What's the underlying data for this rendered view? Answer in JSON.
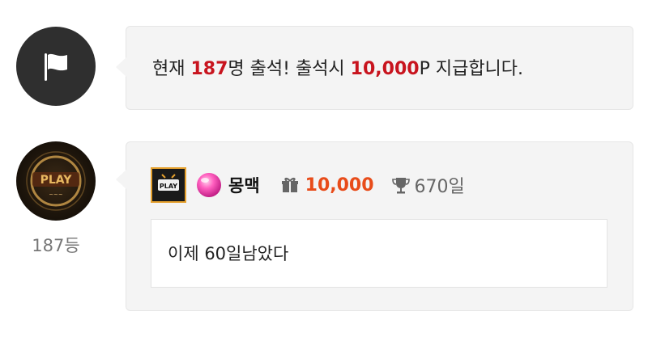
{
  "notice": {
    "icon": "flag-icon",
    "prefix": "현재 ",
    "count": "187",
    "mid": "명 출석! 출석시 ",
    "reward": "10,000",
    "suffix": "P 지급합니다."
  },
  "entry": {
    "avatar_icon": "play-logo-avatar",
    "avatar_text": "PLAY",
    "rank": "187등",
    "level_badge_text": "PLAY",
    "gem_icon": "pink-gem-icon",
    "nickname": "몽맥",
    "gift_icon": "gift-icon",
    "points": "10,000",
    "trophy_icon": "trophy-icon",
    "days": "670일",
    "comment": "이제 60일남았다"
  },
  "colors": {
    "highlight_red": "#c8141e",
    "points_orange": "#e84c1a",
    "bubble_bg": "#f4f4f4",
    "avatar_dark": "#2f2f2f"
  }
}
